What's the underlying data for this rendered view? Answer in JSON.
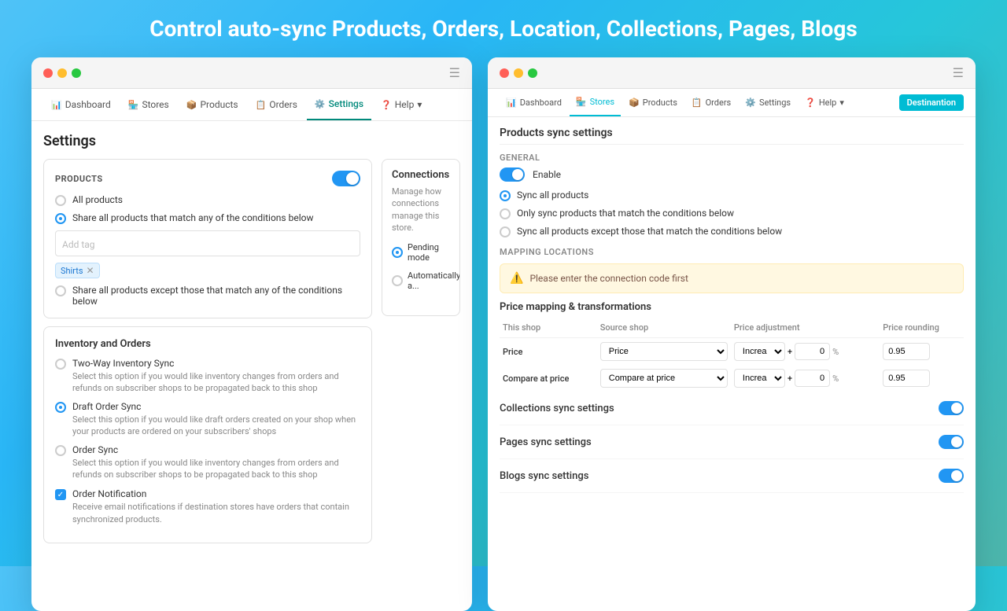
{
  "page": {
    "title": "Control auto-sync Products, Orders, Location, Collections, Pages, Blogs"
  },
  "left_panel": {
    "nav": {
      "items": [
        {
          "label": "Dashboard",
          "icon": "📊",
          "active": false
        },
        {
          "label": "Stores",
          "icon": "🏪",
          "active": false
        },
        {
          "label": "Products",
          "icon": "📦",
          "active": false
        },
        {
          "label": "Orders",
          "icon": "📋",
          "active": false
        },
        {
          "label": "Settings",
          "icon": "⚙️",
          "active": true
        },
        {
          "label": "Help",
          "icon": "❓",
          "active": false
        }
      ]
    },
    "page_title": "Settings",
    "products_card": {
      "label": "PRODUCTS",
      "toggle_on": true,
      "radio_options": [
        {
          "label": "All products",
          "selected": false
        },
        {
          "label": "Share all products that match any of the conditions below",
          "selected": true
        },
        {
          "label": "Share all products except those that match any of the conditions below",
          "selected": false
        }
      ],
      "tag_placeholder": "Add tag",
      "tags": [
        "Shirts"
      ]
    },
    "inventory_card": {
      "title": "Inventory and Orders",
      "options": [
        {
          "label": "Two-Way Inventory Sync",
          "selected": false,
          "desc": "Select this option if you would like inventory changes from orders and refunds on subscriber shops to be propagated back to this shop"
        },
        {
          "label": "Draft Order Sync",
          "selected": true,
          "desc": "Select this option if you would like draft orders created on your shop when your products are ordered on your subscribers' shops"
        },
        {
          "label": "Order Sync",
          "selected": false,
          "desc": "Select this option if you would like inventory changes from orders and refunds on subscriber shops to be propagated back to this shop"
        }
      ],
      "notification": {
        "label": "Order Notification",
        "checked": true,
        "desc": "Receive email notifications if destination stores have orders that contain synchronized products."
      }
    },
    "connections_card": {
      "title": "Connections",
      "desc": "Manage how connections manage this store.",
      "pending_label": "Pending mode",
      "auto_label": "Automatically a..."
    }
  },
  "right_panel": {
    "nav": {
      "items": [
        {
          "label": "Dashboard",
          "icon": "📊",
          "active": false
        },
        {
          "label": "Stores",
          "icon": "🏪",
          "active": false
        },
        {
          "label": "Products",
          "icon": "📦",
          "active": false
        },
        {
          "label": "Orders",
          "icon": "📋",
          "active": false
        },
        {
          "label": "Settings",
          "icon": "⚙️",
          "active": false
        },
        {
          "label": "Help",
          "icon": "❓",
          "active": false
        }
      ],
      "destination_badge": "Destinantion"
    },
    "products_sync_title": "Products sync settings",
    "general_label": "General",
    "enable_label": "Enable",
    "sync_options": [
      {
        "label": "Sync all products",
        "selected": true
      },
      {
        "label": "Only sync products that match the conditions below",
        "selected": false
      },
      {
        "label": "Sync all products except those that match the conditions below",
        "selected": false
      }
    ],
    "mapping_locations_label": "MAPPING LOCATIONS",
    "warning_text": "Please enter the connection code first",
    "price_mapping_title": "Price mapping & transformations",
    "table_headers": [
      "This shop",
      "Source shop",
      "Price adjustment",
      "Price rounding"
    ],
    "table_rows": [
      {
        "this_shop": "Price",
        "source_shop": "Price",
        "adjustment_type": "Increase",
        "adjustment_value": "0",
        "rounding": "0.95"
      },
      {
        "this_shop": "Compare at price",
        "source_shop": "Compare at price",
        "adjustment_type": "Increase",
        "adjustment_value": "0",
        "rounding": "0.95"
      }
    ],
    "collections_sync_label": "Collections sync settings",
    "pages_sync_label": "Pages sync settings",
    "blogs_sync_label": "Blogs sync settings"
  }
}
